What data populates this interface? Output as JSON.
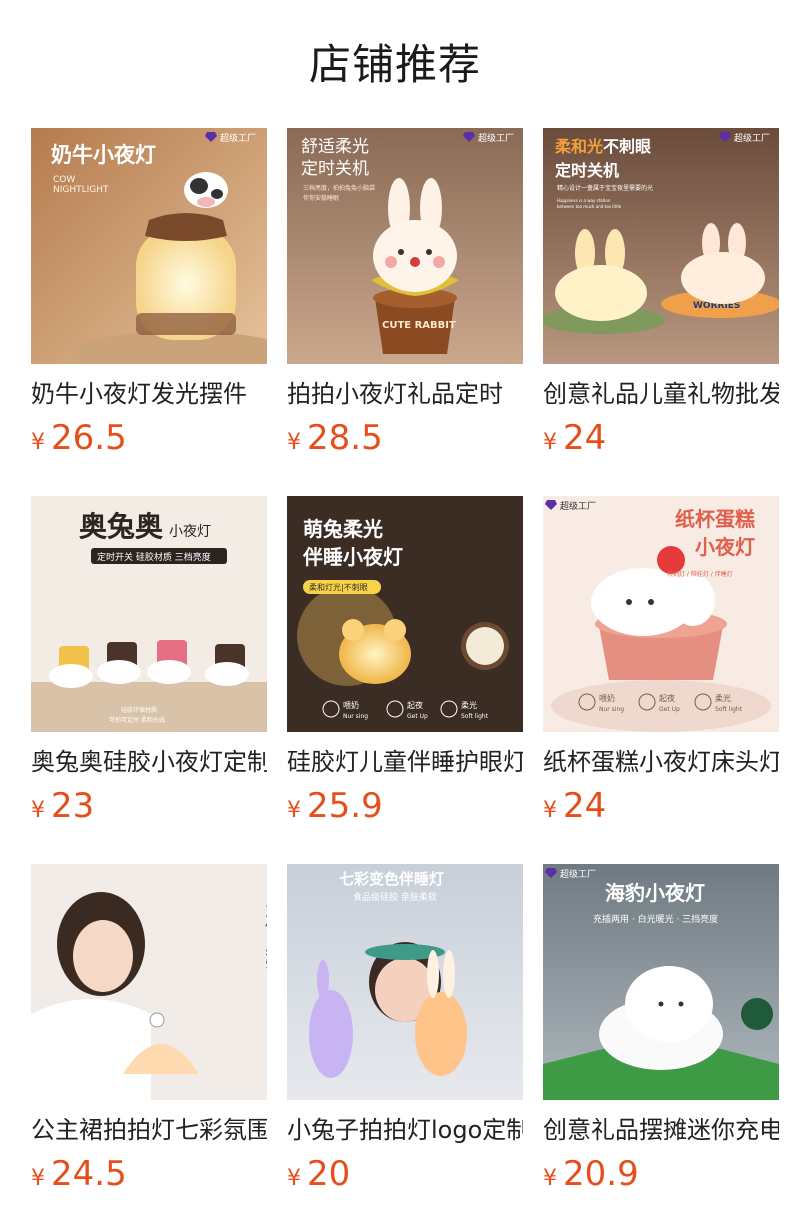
{
  "header": {
    "title": "店铺推荐"
  },
  "colors": {
    "price": "#e4501c",
    "badge": "#5b2ea6"
  },
  "products": [
    {
      "name": "奶牛小夜灯发光摆件",
      "currency": "¥",
      "price": "26.5",
      "image": {
        "headline": "奶牛小夜灯",
        "sub1": "COW",
        "sub2": "NIGHTLIGHT",
        "badge": "超级工厂",
        "icon": "cow-lamp"
      }
    },
    {
      "name": "拍拍小夜灯礼品定时",
      "currency": "¥",
      "price": "28.5",
      "image": {
        "headline1": "舒适柔光",
        "headline2": "定时关机",
        "sub1": "三档亮度，拍拍兔兔小脑袋",
        "sub2": "伴你安稳睡眠",
        "pot_text": "CUTE RABBIT",
        "badge": "超级工厂",
        "icon": "rabbit-pot-lamp"
      }
    },
    {
      "name": "创意礼品儿童礼物批发",
      "currency": "¥",
      "price": "24",
      "image": {
        "headline_a": "柔和光",
        "headline_b": "不刺眼",
        "headline2": "定时关机",
        "sub1": "精心设计一盏属于宝宝夜里需要的光",
        "sub2": "Happiness is a way station",
        "sub3": "between too much and too little",
        "base_text": "WORRIES",
        "badge": "超级工厂",
        "icon": "rabbit-duo-lamp"
      }
    },
    {
      "name": "奥兔奥硅胶小夜灯定制",
      "currency": "¥",
      "price": "23",
      "image": {
        "headline": "奥兔奥",
        "headline_small": "小夜灯",
        "tagline": "定时开关  硅胶材质  三档亮度",
        "foot1": "硅胶环保材质",
        "foot2": "可拍可定时 柔和光线",
        "icon": "oreo-rabbit-lamp"
      }
    },
    {
      "name": "硅胶灯儿童伴睡护眼灯",
      "currency": "¥",
      "price": "25.9",
      "image": {
        "headline1": "萌兔柔光",
        "headline2": "伴睡小夜灯",
        "pill": "柔和灯光|不刺眼",
        "f1a": "喂奶",
        "f1b": "Nur sing",
        "f2a": "起夜",
        "f2b": "Get Up",
        "f3a": "柔光",
        "f3b": "Soft light",
        "icon": "bear-lamp"
      }
    },
    {
      "name": "纸杯蛋糕小夜灯床头灯",
      "currency": "¥",
      "price": "24",
      "image": {
        "badge": "超级工厂",
        "headline1": "纸杯蛋糕",
        "headline2": "小夜灯",
        "tagline": "喂奶灯 / 陪娃灯 / 伴睡灯",
        "f1a": "喂奶",
        "f1b": "Nur sing",
        "f2a": "起夜",
        "f2b": "Get Up",
        "f3a": "柔光",
        "f3b": "Soft light",
        "icon": "cupcake-lamp"
      }
    },
    {
      "name": "公主裙拍拍灯七彩氛围灯",
      "currency": "¥",
      "price": "24.5",
      "image": {
        "v1": "洁白纱裙",
        "v2": "为你点亮",
        "icon": "skirt-lamp"
      }
    },
    {
      "name": "小兔子拍拍灯logo定制",
      "currency": "¥",
      "price": "20",
      "image": {
        "headline": "七彩变色伴睡灯",
        "sub": "食品级硅胶  亲肤柔软",
        "icon": "rabbit-ear-lamp"
      }
    },
    {
      "name": "创意礼品摆摊迷你充电",
      "currency": "¥",
      "price": "20.9",
      "image": {
        "badge": "超级工厂",
        "headline": "海豹小夜灯",
        "sub": "充插两用 · 白光暖光 · 三挡亮度",
        "icon": "seal-lamp"
      }
    }
  ]
}
